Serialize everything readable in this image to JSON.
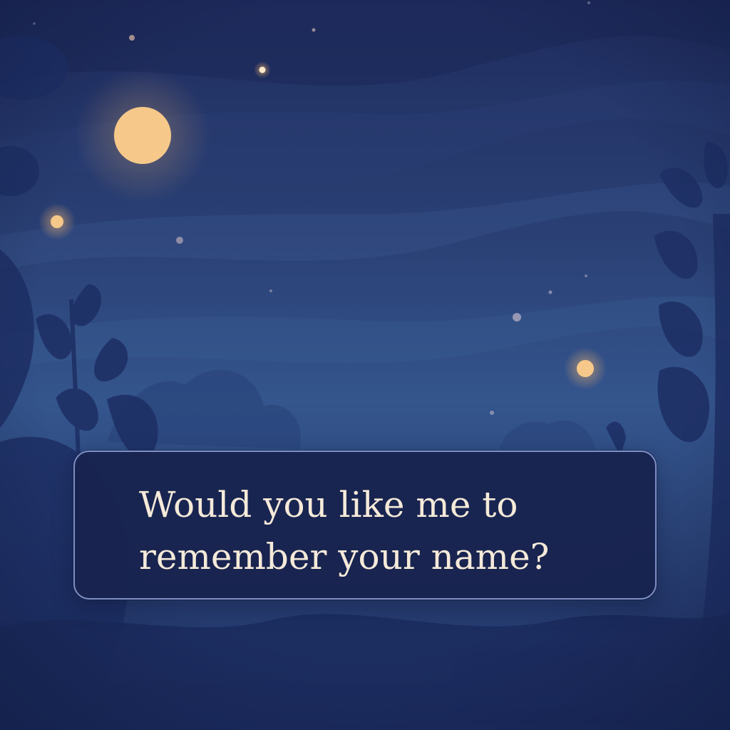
{
  "dialog": {
    "line1": "Would you like me to",
    "line2": "remember your name?"
  },
  "colors": {
    "sky_top": "#1f2c5e",
    "sky_mid": "#34558d",
    "sky_bottom": "#22346a",
    "moon": "#f6c98a",
    "glow": "#f3b56d",
    "foliage": "#1e3066",
    "dialog_fill": "#18224e",
    "dialog_border": "#7d8fc3",
    "dialog_text": "#f5ead9"
  }
}
